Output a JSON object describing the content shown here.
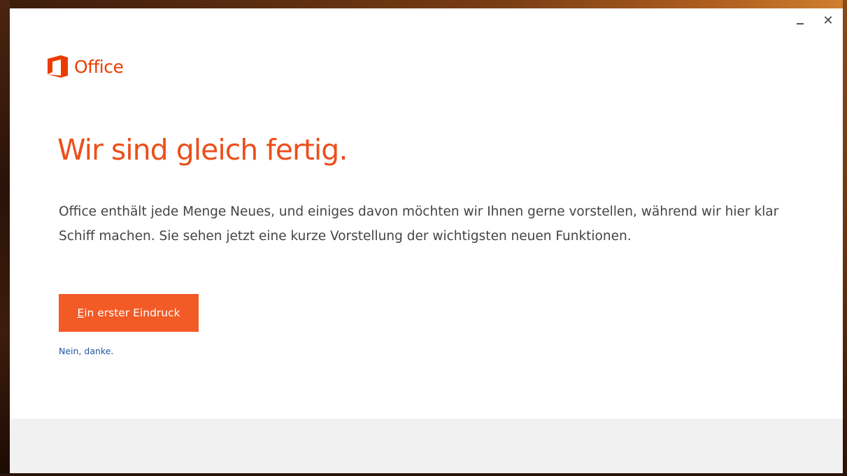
{
  "window": {
    "minimize_label": "–",
    "close_label": "✕"
  },
  "logo": {
    "text": "Office",
    "icon": "office-logo-icon",
    "color": "#eb3c00"
  },
  "content": {
    "headline": "Wir sind gleich fertig.",
    "body": "Office enthält jede Menge Neues, und einiges davon möchten wir Ihnen gerne vorstellen, während wir hier klar Schiff machen. Sie sehen jetzt eine kurze Vorstellung der wichtigsten neuen Funktionen.",
    "primary_button": {
      "access_key": "E",
      "label_rest": "in erster Eindruck",
      "color": "#f25a26"
    },
    "decline_link": "Nein, danke."
  },
  "colors": {
    "accent": "#eb4f1c",
    "link": "#1e57a6",
    "footer": "#f1f1f1"
  }
}
